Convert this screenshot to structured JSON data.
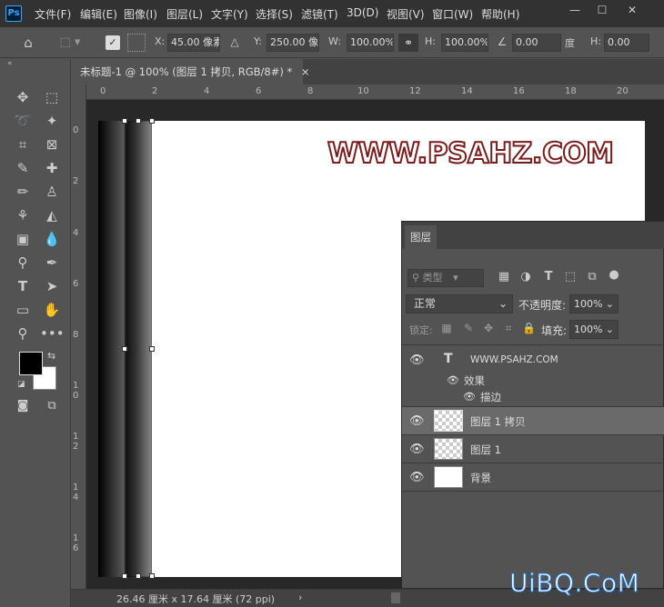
{
  "menu": {
    "logo": "Ps",
    "items": [
      "文件(F)",
      "编辑(E)",
      "图像(I)",
      "图层(L)",
      "文字(Y)",
      "选择(S)",
      "滤镜(T)",
      "3D(D)",
      "视图(V)",
      "窗口(W)",
      "帮助(H)"
    ]
  },
  "window_controls": {
    "minimize": "—",
    "restore": "☐",
    "close": "✕"
  },
  "options": {
    "x_label": "X:",
    "x_value": "45.00 像素",
    "y_label": "Y:",
    "y_value": "250.00 像素",
    "w_label": "W:",
    "w_value": "100.00%",
    "h_label": "H:",
    "h_value": "100.00%",
    "angle_value": "0.00",
    "angle_unit": "度",
    "h_skew_label": "H:",
    "h_skew_value": "0.00"
  },
  "document_tab": {
    "title": "未标题-1 @ 100% (图层 1 拷贝, RGB/8#) *",
    "close": "×"
  },
  "hruler_ticks": [
    "0",
    "2",
    "4",
    "6",
    "8",
    "10",
    "12",
    "14",
    "16",
    "18",
    "20"
  ],
  "vruler_ticks": [
    "0",
    "2",
    "4",
    "6",
    "8",
    "10",
    "12",
    "14",
    "16"
  ],
  "canvas": {
    "text": "WWW.PSAHZ.COM",
    "text_color": "#ffffff",
    "stroke_color": "#7a1a1a"
  },
  "status": {
    "doc_size": "26.46 厘米 x 17.64 厘米 (72 ppi)",
    "arrow": "›"
  },
  "layers_panel": {
    "tab": "图层",
    "filter_kind": "类型",
    "blend_mode": "正常",
    "opacity_label": "不透明度:",
    "opacity_value": "100%",
    "lock_label": "锁定:",
    "fill_label": "填充:",
    "fill_value": "100%",
    "layers": [
      {
        "name": "WWW.PSAHZ.COM",
        "type": "text",
        "icon": "T"
      },
      {
        "name": "效果",
        "type": "effects"
      },
      {
        "name": "描边",
        "type": "effect-item"
      },
      {
        "name": "图层 1 拷贝",
        "type": "pixel",
        "selected": true
      },
      {
        "name": "图层 1",
        "type": "pixel"
      },
      {
        "name": "背景",
        "type": "background"
      }
    ]
  },
  "watermark": "UiBQ.CoM"
}
